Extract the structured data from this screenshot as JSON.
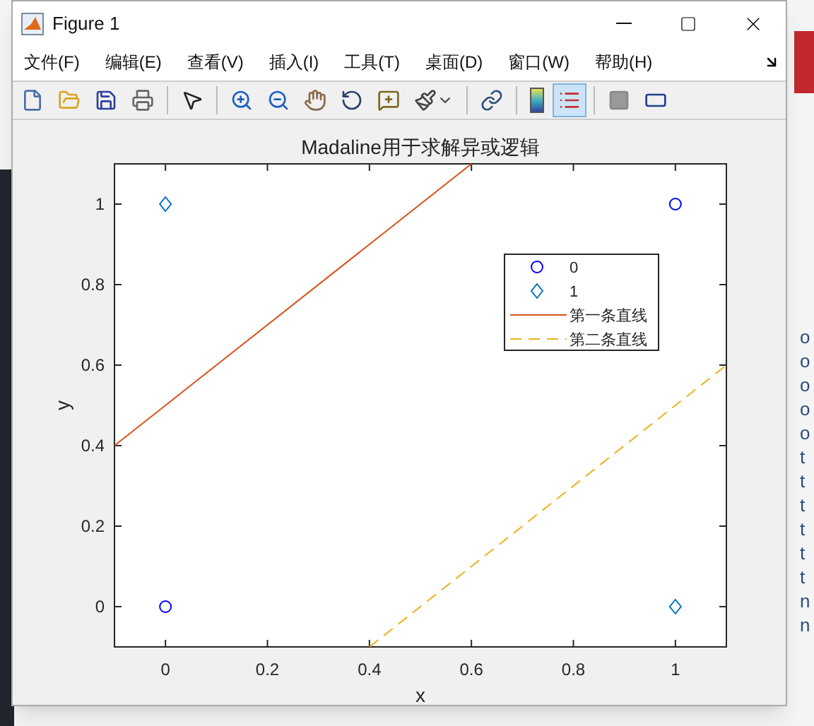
{
  "window": {
    "title": "Figure 1"
  },
  "menu": [
    "文件(F)",
    "编辑(E)",
    "查看(V)",
    "插入(I)",
    "工具(T)",
    "桌面(D)",
    "窗口(W)",
    "帮助(H)"
  ],
  "toolbar": [
    {
      "kind": "new",
      "selected": false
    },
    {
      "kind": "open",
      "selected": false
    },
    {
      "kind": "save",
      "selected": false
    },
    {
      "kind": "print",
      "selected": false
    },
    {
      "kind": "separator"
    },
    {
      "kind": "pointer",
      "selected": false
    },
    {
      "kind": "separator"
    },
    {
      "kind": "zoomin",
      "selected": false
    },
    {
      "kind": "zoomout",
      "selected": false
    },
    {
      "kind": "pan",
      "selected": false
    },
    {
      "kind": "rotate",
      "selected": false
    },
    {
      "kind": "datacursor",
      "selected": false
    },
    {
      "kind": "brush",
      "selected": false
    },
    {
      "kind": "separator"
    },
    {
      "kind": "link",
      "selected": false
    },
    {
      "kind": "separator"
    },
    {
      "kind": "colorbar",
      "selected": false
    },
    {
      "kind": "legend",
      "selected": true
    },
    {
      "kind": "separator"
    },
    {
      "kind": "hidetools",
      "selected": false
    },
    {
      "kind": "showtools",
      "selected": false
    }
  ],
  "chart_data": {
    "type": "scatter",
    "title": "Madaline用于求解异或逻辑",
    "xlabel": "x",
    "ylabel": "y",
    "xlim": [
      -0.1,
      1.1
    ],
    "ylim": [
      -0.1,
      1.1
    ],
    "xticks": [
      {
        "value": 0,
        "label": "0"
      },
      {
        "value": 0.2,
        "label": "0.2"
      },
      {
        "value": 0.4,
        "label": "0.4"
      },
      {
        "value": 0.6,
        "label": "0.6"
      },
      {
        "value": 0.8,
        "label": "0.8"
      },
      {
        "value": 1,
        "label": "1"
      }
    ],
    "yticks": [
      {
        "value": 0,
        "label": "0"
      },
      {
        "value": 0.2,
        "label": "0.2"
      },
      {
        "value": 0.4,
        "label": "0.4"
      },
      {
        "value": 0.6,
        "label": "0.6"
      },
      {
        "value": 0.8,
        "label": "0.8"
      },
      {
        "value": 1,
        "label": "1"
      }
    ],
    "legend": true,
    "series": [
      {
        "name": "0",
        "color": "#0000ff",
        "marker": "circle",
        "x": [
          0,
          1
        ],
        "values": [
          0,
          1
        ]
      },
      {
        "name": "1",
        "color": "#0072bd",
        "marker": "diamond",
        "x": [
          0,
          1
        ],
        "values": [
          1,
          0
        ]
      },
      {
        "name": "第一条直线",
        "color": "#d95319",
        "type": "line",
        "line_style": "solid",
        "x": [
          -0.1,
          0.6
        ],
        "values": [
          0.4,
          1.1
        ]
      },
      {
        "name": "第二条直线",
        "color": "#edb120",
        "type": "line",
        "line_style": "dashed",
        "x": [
          0.4,
          1.1
        ],
        "values": [
          -0.1,
          0.6
        ]
      }
    ]
  },
  "background": {
    "fragments": [
      "o",
      "o",
      "o",
      "o",
      "o",
      "t",
      "t",
      "t",
      "t",
      "t",
      "t",
      "n",
      "n"
    ]
  }
}
